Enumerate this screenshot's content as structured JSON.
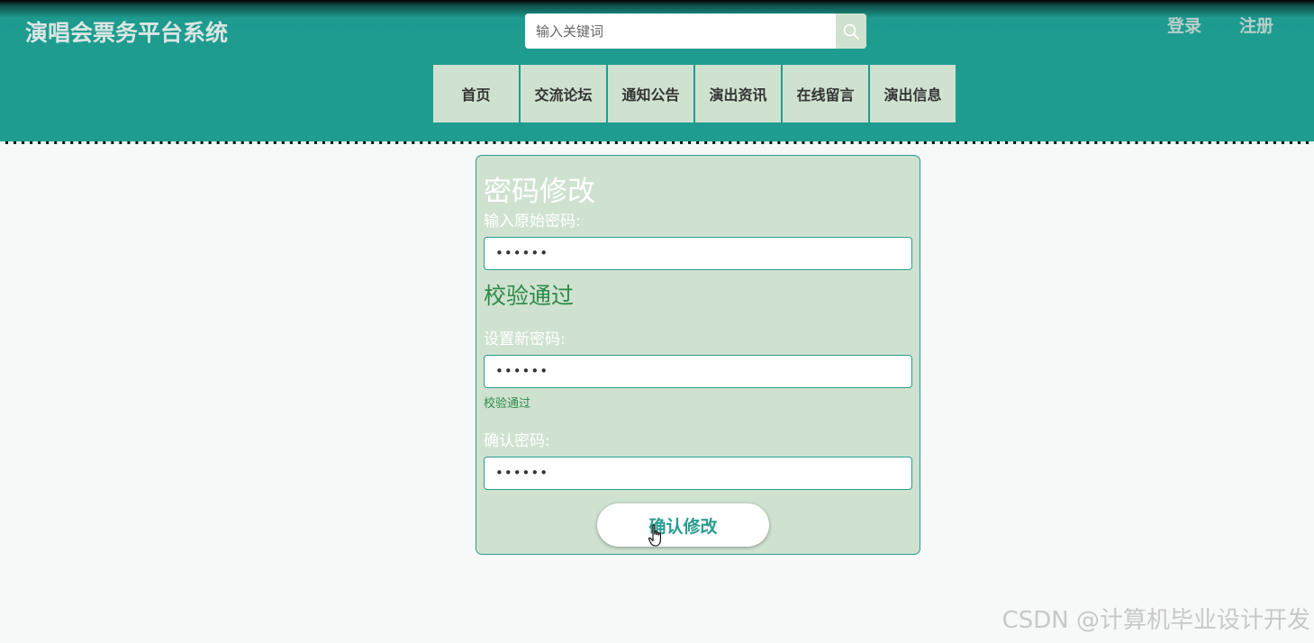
{
  "header": {
    "site_title": "演唱会票务平台系统",
    "search_placeholder": "输入关键词",
    "login_label": "登录",
    "register_label": "注册",
    "search_icon": "search-icon"
  },
  "nav": {
    "items": [
      {
        "label": "首页"
      },
      {
        "label": "交流论坛"
      },
      {
        "label": "通知公告"
      },
      {
        "label": "演出资讯"
      },
      {
        "label": "在线留言"
      },
      {
        "label": "演出信息"
      }
    ]
  },
  "form": {
    "title": "密码修改",
    "old_password_label": "输入原始密码:",
    "old_password_value": "••••••",
    "old_password_status": "校验通过",
    "new_password_label": "设置新密码:",
    "new_password_value": "••••••",
    "new_password_status": "校验通过",
    "confirm_password_label": "确认密码:",
    "confirm_password_value": "••••••",
    "submit_label": "确认修改"
  },
  "watermark": "CSDN @计算机毕业设计开发",
  "colors": {
    "header_teal": "#1f9c90",
    "card_bg": "#cfe2d0",
    "accent": "#2a9c8f",
    "success_green": "#2c8a48"
  }
}
